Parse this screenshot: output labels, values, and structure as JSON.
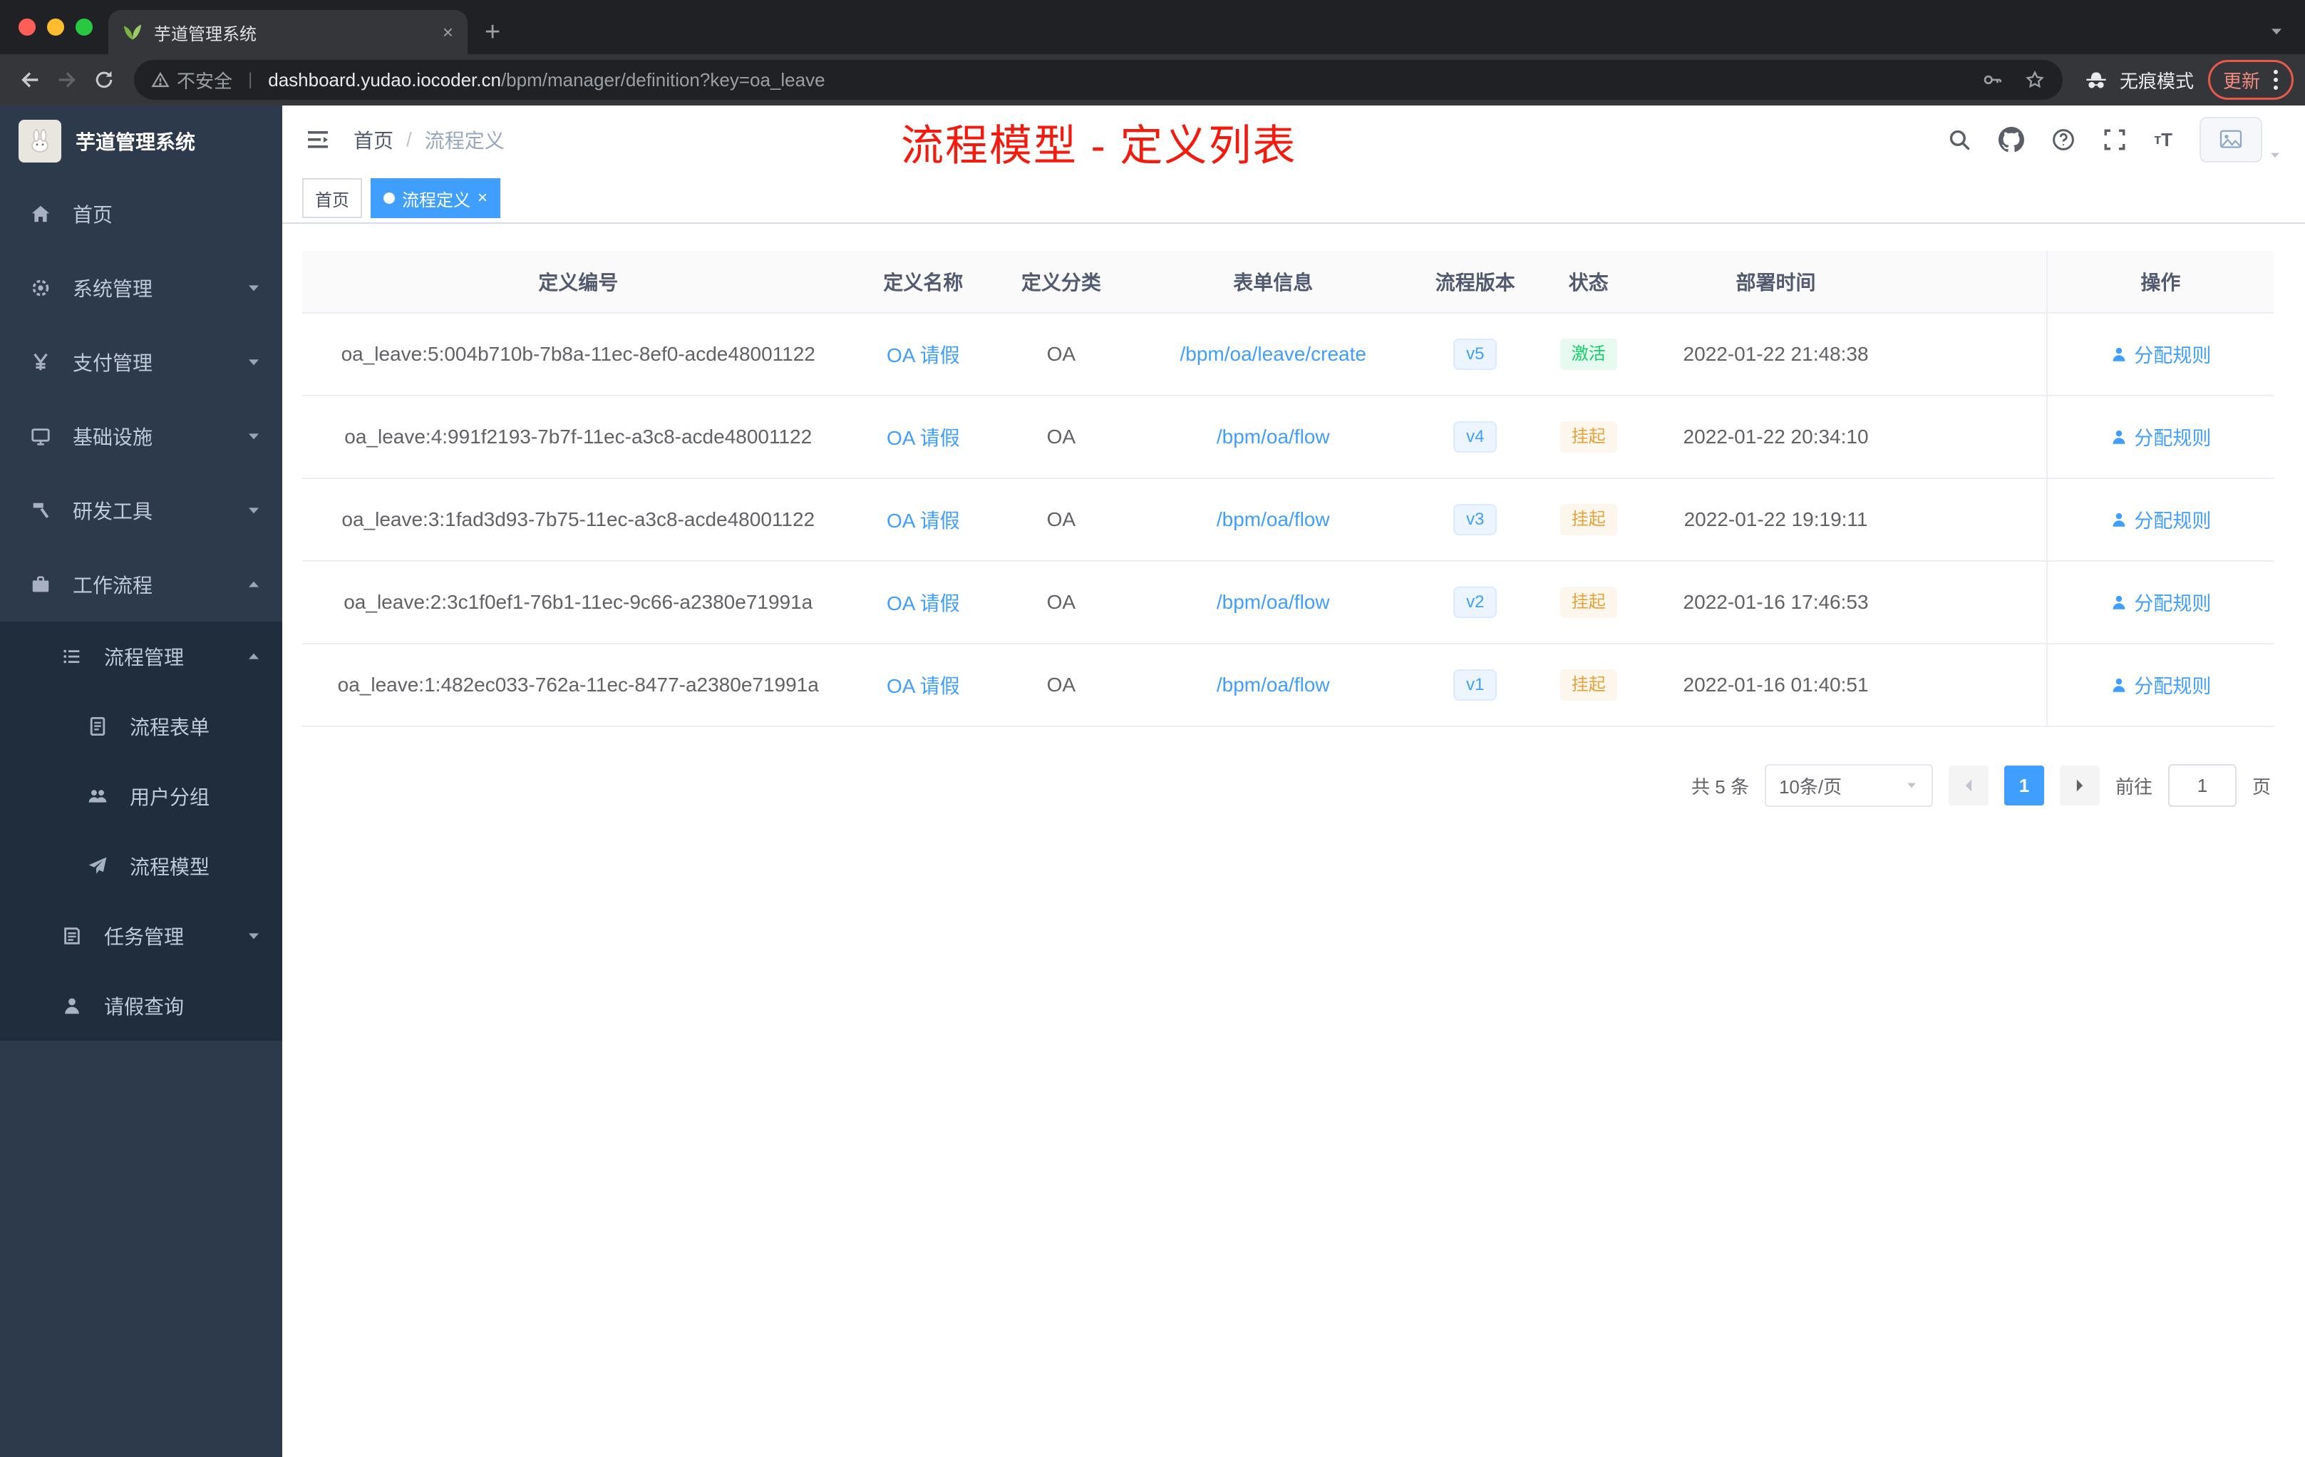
{
  "browser": {
    "tab_title": "芋道管理系统",
    "security_label": "不安全",
    "url_domain": "dashboard.yudao.iocoder.cn",
    "url_path": "/bpm/manager/definition?key=oa_leave",
    "incognito_label": "无痕模式",
    "update_label": "更新"
  },
  "sidebar": {
    "logo_title": "芋道管理系统",
    "items": [
      {
        "label": "首页",
        "icon": "home-icon",
        "level": 1,
        "arrow": ""
      },
      {
        "label": "系统管理",
        "icon": "gear-icon",
        "level": 1,
        "arrow": "down"
      },
      {
        "label": "支付管理",
        "icon": "yen-icon",
        "level": 1,
        "arrow": "down"
      },
      {
        "label": "基础设施",
        "icon": "infra-icon",
        "level": 1,
        "arrow": "down"
      },
      {
        "label": "研发工具",
        "icon": "tools-icon",
        "level": 1,
        "arrow": "down"
      },
      {
        "label": "工作流程",
        "icon": "workflow-icon",
        "level": 1,
        "arrow": "up"
      },
      {
        "label": "流程管理",
        "icon": "process-icon",
        "level": 2,
        "arrow": "up"
      },
      {
        "label": "流程表单",
        "icon": "form-icon",
        "level": 3,
        "arrow": ""
      },
      {
        "label": "用户分组",
        "icon": "group-icon",
        "level": 3,
        "arrow": ""
      },
      {
        "label": "流程模型",
        "icon": "model-icon",
        "level": 3,
        "arrow": ""
      },
      {
        "label": "任务管理",
        "icon": "task-icon",
        "level": 2,
        "arrow": "down"
      },
      {
        "label": "请假查询",
        "icon": "user-icon",
        "level": 2,
        "arrow": ""
      }
    ]
  },
  "header": {
    "breadcrumb": [
      "首页",
      "流程定义"
    ],
    "breadcrumb_sep": "/",
    "annotation": "流程模型 - 定义列表"
  },
  "tags": [
    {
      "label": "首页",
      "active": false,
      "closable": false
    },
    {
      "label": "流程定义",
      "active": true,
      "closable": true
    }
  ],
  "table": {
    "columns": [
      "定义编号",
      "定义名称",
      "定义分类",
      "表单信息",
      "流程版本",
      "状态",
      "部署时间",
      "操作"
    ],
    "rows": [
      {
        "id": "oa_leave:5:004b710b-7b8a-11ec-8ef0-acde48001122",
        "name": "OA 请假",
        "category": "OA",
        "form": "/bpm/oa/leave/create",
        "version": "v5",
        "status": "激活",
        "status_type": "success",
        "deployed": "2022-01-22 21:48:38",
        "action": "分配规则"
      },
      {
        "id": "oa_leave:4:991f2193-7b7f-11ec-a3c8-acde48001122",
        "name": "OA 请假",
        "category": "OA",
        "form": "/bpm/oa/flow",
        "version": "v4",
        "status": "挂起",
        "status_type": "warning",
        "deployed": "2022-01-22 20:34:10",
        "action": "分配规则"
      },
      {
        "id": "oa_leave:3:1fad3d93-7b75-11ec-a3c8-acde48001122",
        "name": "OA 请假",
        "category": "OA",
        "form": "/bpm/oa/flow",
        "version": "v3",
        "status": "挂起",
        "status_type": "warning",
        "deployed": "2022-01-22 19:19:11",
        "action": "分配规则"
      },
      {
        "id": "oa_leave:2:3c1f0ef1-76b1-11ec-9c66-a2380e71991a",
        "name": "OA 请假",
        "category": "OA",
        "form": "/bpm/oa/flow",
        "version": "v2",
        "status": "挂起",
        "status_type": "warning",
        "deployed": "2022-01-16 17:46:53",
        "action": "分配规则"
      },
      {
        "id": "oa_leave:1:482ec033-762a-11ec-8477-a2380e71991a",
        "name": "OA 请假",
        "category": "OA",
        "form": "/bpm/oa/flow",
        "version": "v1",
        "status": "挂起",
        "status_type": "warning",
        "deployed": "2022-01-16 01:40:51",
        "action": "分配规则"
      }
    ]
  },
  "pagination": {
    "total": "共 5 条",
    "page_size": "10条/页",
    "current_page": "1",
    "goto_label": "前往",
    "goto_value": "1",
    "page_unit": "页"
  },
  "colors": {
    "accent": "#409eff",
    "annotation_red": "#f21b0e",
    "success": "#13ce66",
    "warning": "#e6a23c",
    "sidebar_bg": "#2d3a4b",
    "submenu_bg": "#1f2d3d"
  }
}
